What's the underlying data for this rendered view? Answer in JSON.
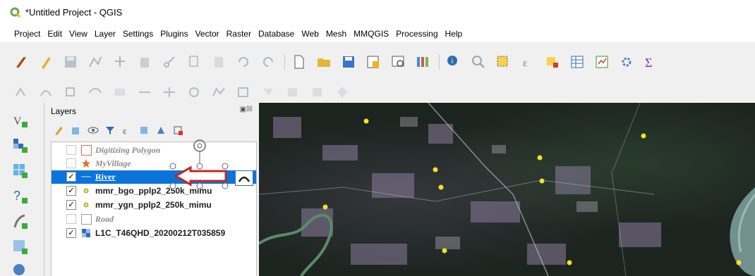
{
  "window": {
    "title": "*Untitled Project - QGIS"
  },
  "menu": [
    "Project",
    "Edit",
    "View",
    "Layer",
    "Settings",
    "Plugins",
    "Vector",
    "Raster",
    "Database",
    "Web",
    "Mesh",
    "MMQGIS",
    "Processing",
    "Help"
  ],
  "toolbar_main": [
    "digitize-pencil-icon",
    "edit-pencil-icon",
    "save-edits-icon",
    "add-vertex-icon",
    "move-feature-icon",
    "delete-feature-icon",
    "cut-icon",
    "copy-icon",
    "paste-icon",
    "undo-icon",
    "redo-icon",
    "new-project-icon",
    "open-project-icon",
    "save-project-icon",
    "print-layout-icon",
    "layout-manager-icon",
    "style-manager-icon",
    "identify-icon",
    "zoom-tool-icon",
    "select-feature-icon",
    "select-expression-icon",
    "deselect-icon",
    "attribute-table-icon",
    "field-calculator-icon",
    "settings-gear-icon",
    "sum-icon"
  ],
  "toolbar_secondary": [
    "snap-icon",
    "digitize-curve-icon",
    "node-tool-icon",
    "reshape-icon",
    "offset-curve-icon",
    "split-icon",
    "merge-icon",
    "rotate-icon",
    "simplify-icon",
    "add-ring-icon",
    "fill-ring-icon",
    "delete-part-icon",
    "reshape-features-icon",
    "select-vertices-icon"
  ],
  "left_toolbar": [
    "add-vector-layer-icon",
    "add-raster-layer-icon",
    "add-mesh-layer-icon",
    "add-delimited-text-icon",
    "add-spatialite-icon",
    "add-virtual-layer-icon",
    "add-wms-icon"
  ],
  "layers_panel": {
    "title": "Layers",
    "layers": [
      {
        "name": "Digitizing Polygon",
        "checked": false,
        "style": "italic"
      },
      {
        "name": "MyVillage",
        "checked": false,
        "style": "italic"
      },
      {
        "name": "River",
        "checked": true,
        "style": "selected"
      },
      {
        "name": "mmr_bgo_pplp2_250k_mimu",
        "checked": true,
        "style": "bold"
      },
      {
        "name": "mmr_ygn_pplp2_250k_mimu",
        "checked": true,
        "style": "bold"
      },
      {
        "name": "Road",
        "checked": false,
        "style": "italic"
      },
      {
        "name": "L1C_T46QHD_20200212T035859",
        "checked": true,
        "style": "bold"
      }
    ]
  },
  "colors": {
    "selection": "#0a74da",
    "annotation_arrow": "#c0282a",
    "map_points": "#f1e12c",
    "river": "#5c8a6a"
  }
}
